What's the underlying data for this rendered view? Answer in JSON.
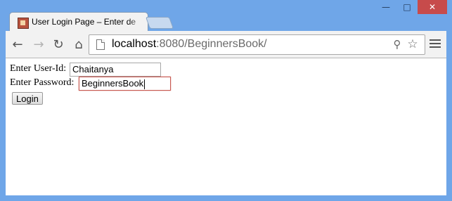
{
  "browser": {
    "tab": {
      "title": "User Login Page – Enter de"
    },
    "address": {
      "host": "localhost",
      "rest": ":8080/BeginnersBook/"
    }
  },
  "form": {
    "userid": {
      "label": "Enter User-Id:",
      "value": "Chaitanya"
    },
    "password": {
      "label": "Enter Password:",
      "value": "BeginnersBook"
    },
    "submit_label": "Login"
  },
  "colors": {
    "frame": "#6fa6e8",
    "focus_border": "#c85a52",
    "close_button": "#c74b4b"
  }
}
